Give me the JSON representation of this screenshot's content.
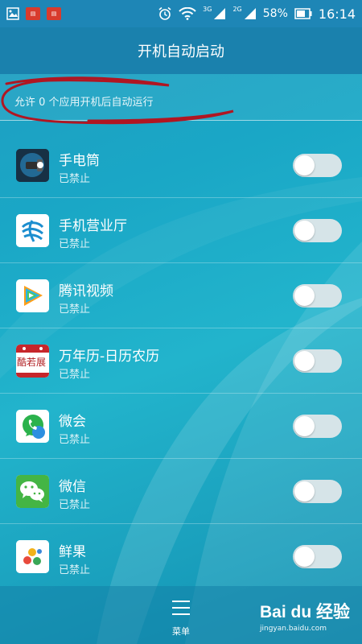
{
  "status_bar": {
    "network_label_1": "3G",
    "network_label_2": "2G",
    "battery": "58%",
    "time": "16:14",
    "icons": [
      "image-icon",
      "notification-icon",
      "notification-icon",
      "alarm-icon",
      "wifi-icon",
      "signal-icon",
      "signal-icon",
      "battery-icon"
    ]
  },
  "header": {
    "title": "开机自动启动"
  },
  "summary": {
    "text": "允许 0 个应用开机后自动运行"
  },
  "apps": [
    {
      "name": "手电筒",
      "status": "已禁止",
      "icon": "flashlight-icon",
      "enabled": false
    },
    {
      "name": "手机营业厅",
      "status": "已禁止",
      "icon": "china-mobile-icon",
      "enabled": false
    },
    {
      "name": "腾讯视频",
      "status": "已禁止",
      "icon": "tencent-video-icon",
      "enabled": false
    },
    {
      "name": "万年历-日历农历",
      "status": "已禁止",
      "icon": "calendar-icon",
      "enabled": false
    },
    {
      "name": "微会",
      "status": "已禁止",
      "icon": "weihui-phone-icon",
      "enabled": false
    },
    {
      "name": "微信",
      "status": "已禁止",
      "icon": "wechat-icon",
      "enabled": false
    },
    {
      "name": "鲜果",
      "status": "已禁止",
      "icon": "xianguo-icon",
      "enabled": false
    }
  ],
  "calendar_icon_text": "酷若展",
  "bottom_bar": {
    "menu_label": "菜单"
  },
  "watermark": {
    "logo": "Bai du 经验",
    "url": "jingyan.baidu.com"
  },
  "colors": {
    "status_bar": "#1e86b6",
    "title_bar": "#1a81ad",
    "background": "#1aa7c6",
    "toggle_off": "#d6e4e8",
    "annotation_red": "#b01622"
  }
}
